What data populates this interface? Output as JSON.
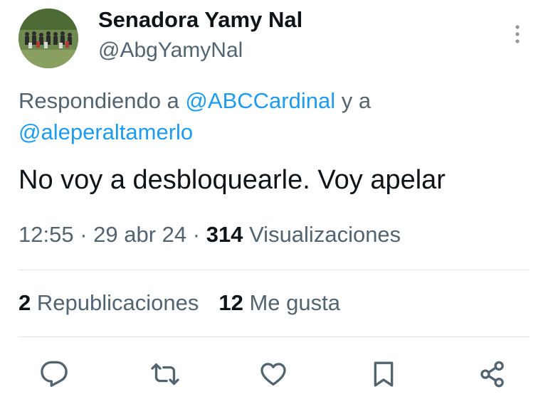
{
  "author": {
    "name": "Senadora Yamy Nal",
    "handle": "@AbgYamyNal",
    "avatar_icon": "avatar-group-photo"
  },
  "header": {
    "more_icon": "more-vertical-icon"
  },
  "reply_context": {
    "prefix": "Respondiendo a ",
    "mentions": [
      "@ABCCardinal",
      "@aleperaltamerlo"
    ],
    "joiner": " y a "
  },
  "tweet": {
    "text": "No voy a desbloquearle. Voy apelar",
    "time": "12:55",
    "separator": " · ",
    "date": "29 abr 24",
    "views_count": "314",
    "views_label": "Visualizaciones"
  },
  "stats": {
    "reposts_count": "2",
    "reposts_label": "Republicaciones",
    "likes_count": "12",
    "likes_label": "Me gusta"
  },
  "actions": [
    {
      "name": "reply",
      "icon": "reply-icon"
    },
    {
      "name": "repost",
      "icon": "repost-icon"
    },
    {
      "name": "like",
      "icon": "heart-icon"
    },
    {
      "name": "bookmark",
      "icon": "bookmark-icon"
    },
    {
      "name": "share",
      "icon": "share-icon"
    }
  ],
  "colors": {
    "text_primary": "#0f1419",
    "text_secondary": "#536471",
    "link": "#1d9bf0",
    "divider": "#dfe3e6"
  }
}
